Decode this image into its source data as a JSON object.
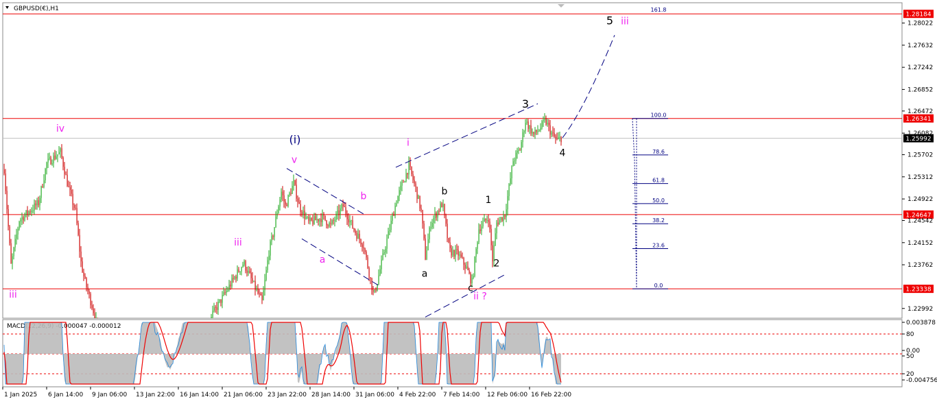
{
  "window_title": "GBPUSD(€),H1",
  "colors": {
    "up": "#22aa22",
    "down": "#cc0000",
    "level": "#ee0000",
    "magenta": "#ee22ee",
    "blue": "#000080",
    "macd_hist": "#bbbbbb",
    "macd_main": "#2288dd",
    "macd_signal": "#ee0000"
  },
  "chart_data": [
    {
      "type": "candlestick",
      "title": "GBPUSD(€),H1",
      "ylim": [
        1.2282,
        1.2838
      ],
      "y_ticks": [
        "1.28022",
        "1.27632",
        "1.27242",
        "1.26852",
        "1.26472",
        "1.26082",
        "1.25702",
        "1.25312",
        "1.24922",
        "1.24542",
        "1.24152",
        "1.23762",
        "1.22992"
      ],
      "x_ticks": [
        "1 Jan 2025",
        "6 Jan 14:00",
        "9 Jan 06:00",
        "13 Jan 22:00",
        "16 Jan 14:00",
        "21 Jan 06:00",
        "23 Jan 22:00",
        "28 Jan 14:00",
        "31 Jan 06:00",
        "4 Feb 22:00",
        "7 Feb 14:00",
        "12 Feb 06:00",
        "16 Feb 22:00"
      ],
      "price_path": [
        [
          0,
          1.254
        ],
        [
          6,
          1.2545
        ],
        [
          16,
          1.2375
        ],
        [
          28,
          1.2455
        ],
        [
          56,
          1.2485
        ],
        [
          68,
          1.2555
        ],
        [
          88,
          1.2575
        ],
        [
          100,
          1.251
        ],
        [
          110,
          1.247
        ],
        [
          118,
          1.238
        ],
        [
          123,
          1.235
        ],
        [
          135,
          1.23
        ],
        [
          160,
          1.218
        ],
        [
          185,
          1.212
        ],
        [
          220,
          1.216
        ],
        [
          250,
          1.215
        ],
        [
          290,
          1.22
        ],
        [
          310,
          1.229
        ],
        [
          330,
          1.233
        ],
        [
          355,
          1.238
        ],
        [
          370,
          1.234
        ],
        [
          382,
          1.231
        ],
        [
          392,
          1.24
        ],
        [
          398,
          1.243
        ],
        [
          404,
          1.247
        ],
        [
          410,
          1.2505
        ],
        [
          416,
          1.248
        ],
        [
          428,
          1.252
        ],
        [
          436,
          1.248
        ],
        [
          450,
          1.245
        ],
        [
          470,
          1.246
        ],
        [
          482,
          1.2445
        ],
        [
          500,
          1.248
        ],
        [
          515,
          1.244
        ],
        [
          530,
          1.241
        ],
        [
          545,
          1.232
        ],
        [
          560,
          1.24
        ],
        [
          578,
          1.249
        ],
        [
          596,
          1.255
        ],
        [
          606,
          1.251
        ],
        [
          614,
          1.247
        ],
        [
          620,
          1.239
        ],
        [
          628,
          1.245
        ],
        [
          645,
          1.2485
        ],
        [
          655,
          1.24
        ],
        [
          668,
          1.2395
        ],
        [
          680,
          1.237
        ],
        [
          688,
          1.2345
        ],
        [
          698,
          1.244
        ],
        [
          712,
          1.246
        ],
        [
          718,
          1.2385
        ],
        [
          724,
          1.245
        ],
        [
          736,
          1.2465
        ],
        [
          748,
          1.256
        ],
        [
          758,
          1.258
        ],
        [
          766,
          1.263
        ],
        [
          778,
          1.2605
        ],
        [
          786,
          1.2615
        ],
        [
          795,
          1.263
        ],
        [
          805,
          1.2605
        ],
        [
          812,
          1.2595
        ],
        [
          818,
          1.26
        ]
      ],
      "horizontal_levels": [
        {
          "price": 1.28184,
          "label": "1.28184"
        },
        {
          "price": 1.26341,
          "label": "1.26341"
        },
        {
          "price": 1.24647,
          "label": "1.24647"
        },
        {
          "price": 1.23338,
          "label": "1.23338"
        }
      ],
      "current_price": {
        "price": 1.25992,
        "label": "1.25992"
      },
      "fibonacci": {
        "low": 1.23338,
        "high": 1.26341,
        "levels": [
          "0.0",
          "23.6",
          "38.2",
          "50.0",
          "61.8",
          "78.6",
          "100.0",
          "161.8"
        ]
      },
      "wave_labels": [
        {
          "text": "iv",
          "price": 1.2611,
          "x": 88,
          "color": "magenta"
        },
        {
          "text": "(i)",
          "price": 1.259,
          "x": 430,
          "color": "blue"
        },
        {
          "text": "v",
          "price": 1.2556,
          "x": 429,
          "color": "magenta"
        },
        {
          "text": "iii",
          "price": 1.241,
          "x": 347,
          "color": "magenta"
        },
        {
          "text": "a",
          "price": 1.238,
          "x": 470,
          "color": "magenta"
        },
        {
          "text": "b",
          "price": 1.2492,
          "x": 530,
          "color": "magenta"
        },
        {
          "text": "i",
          "price": 1.2586,
          "x": 595,
          "color": "magenta"
        },
        {
          "text": "b",
          "price": 1.25,
          "x": 648,
          "color": "black"
        },
        {
          "text": "a",
          "price": 1.2355,
          "x": 619,
          "color": "black"
        },
        {
          "text": "c",
          "price": 1.233,
          "x": 686,
          "color": "black"
        },
        {
          "text": "ii ?",
          "price": 1.2315,
          "x": 700,
          "color": "magenta"
        },
        {
          "text": "1",
          "price": 1.2485,
          "x": 712,
          "color": "black"
        },
        {
          "text": "2",
          "price": 1.2373,
          "x": 724,
          "color": "black"
        },
        {
          "text": "3",
          "price": 1.2653,
          "x": 766,
          "color": "black"
        },
        {
          "text": "4",
          "price": 1.2568,
          "x": 820,
          "color": "black"
        },
        {
          "text": "5",
          "price": 1.28,
          "x": 889,
          "color": "black"
        },
        {
          "text": "iii",
          "price": 1.28,
          "x": 911,
          "color": "magenta"
        },
        {
          "text": "iii",
          "price": 1.2318,
          "x": 19,
          "color": "magenta"
        }
      ]
    },
    {
      "type": "line",
      "title": "MACD(12,26,9) -0.000047 -0.000012",
      "y_ticks": [
        "0.003878",
        "80",
        "0.00",
        "50",
        "20",
        "-0.004756"
      ],
      "series": [
        {
          "name": "MACD",
          "color_key": "macd_hist"
        },
        {
          "name": "Signal",
          "color_key": "macd_signal"
        }
      ]
    }
  ]
}
